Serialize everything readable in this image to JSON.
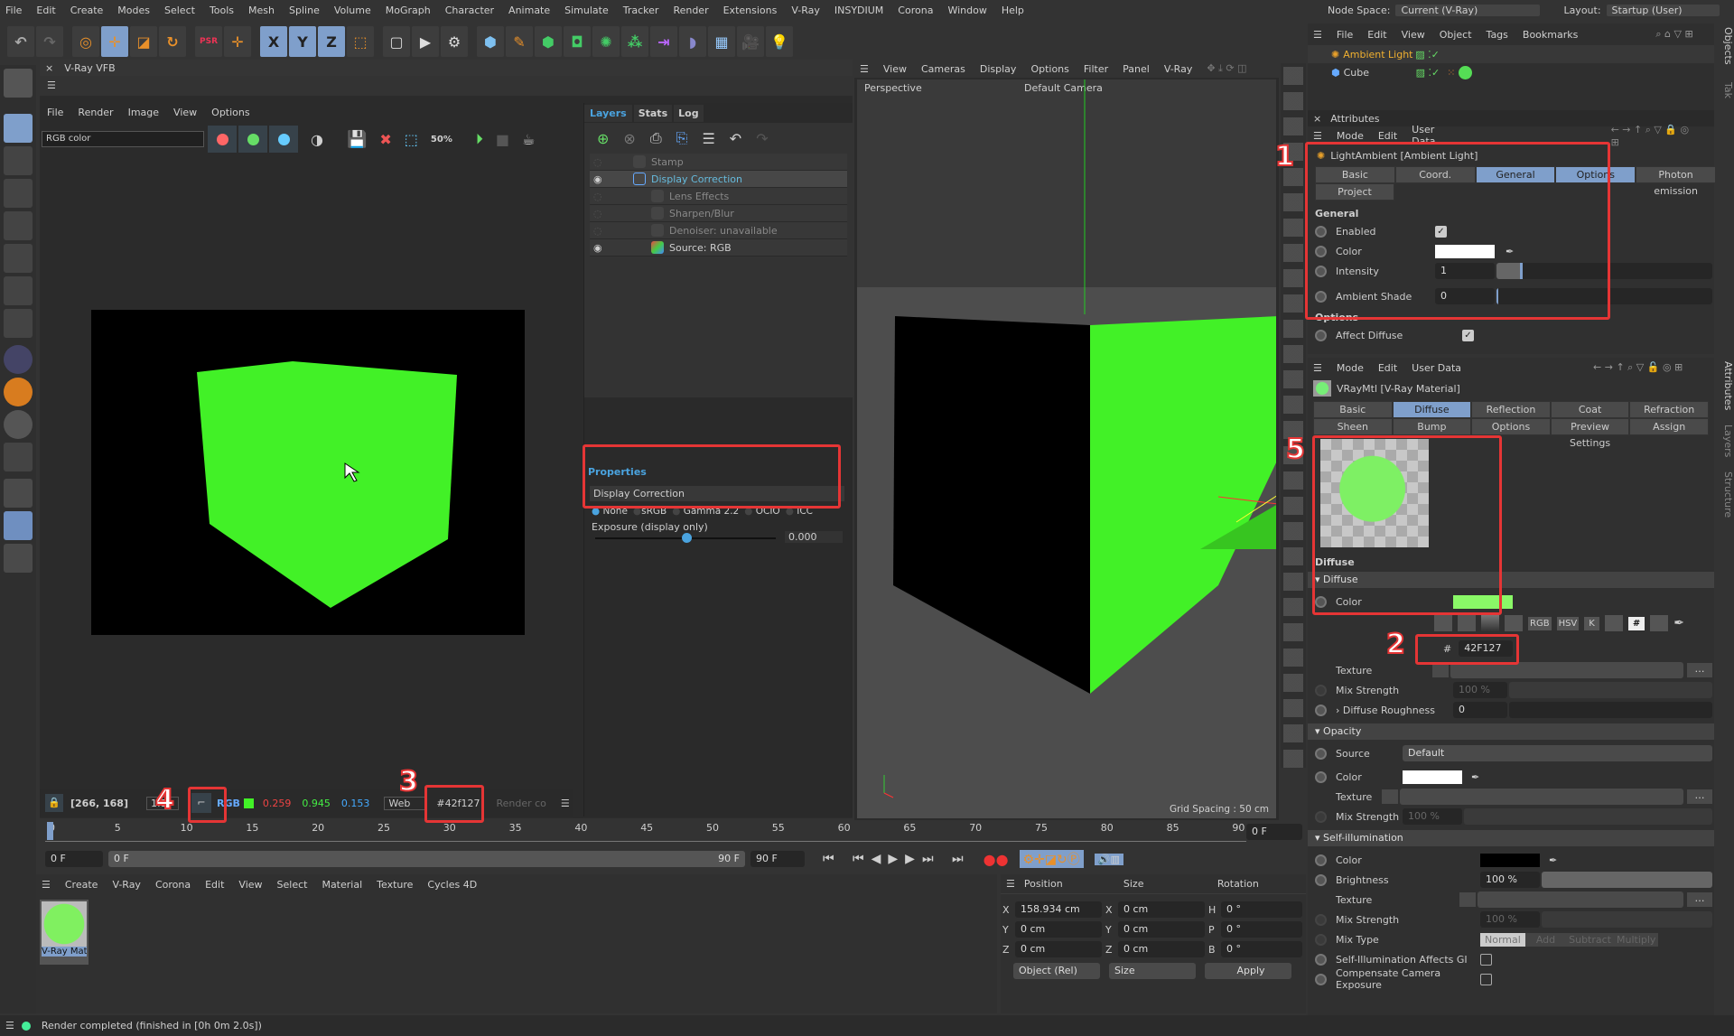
{
  "menubar": {
    "items": [
      "File",
      "Edit",
      "Create",
      "Modes",
      "Select",
      "Tools",
      "Mesh",
      "Spline",
      "Volume",
      "MoGraph",
      "Character",
      "Animate",
      "Simulate",
      "Tracker",
      "Render",
      "Extensions",
      "V-Ray",
      "INSYDIUM",
      "Corona",
      "Window",
      "Help"
    ],
    "node_space_label": "Node Space:",
    "node_space_value": "Current (V-Ray)",
    "layout_label": "Layout:",
    "layout_value": "Startup (User)"
  },
  "toolbar": {
    "icons": [
      "undo-icon",
      "redo-icon",
      "select-icon",
      "move-icon",
      "scale-icon",
      "rotate-icon",
      "psr-icon",
      "axis-icon",
      "x-axis-icon",
      "y-axis-icon",
      "z-axis-icon",
      "coordinate-system-icon",
      "render-view-icon",
      "render-icon",
      "render-settings-icon",
      "cube-icon",
      "pen-icon",
      "subdivision-icon",
      "extrude-icon",
      "cloner-icon",
      "array-icon",
      "symmetry-icon",
      "deformer-icon",
      "floor-icon",
      "camera-icon",
      "light-icon"
    ],
    "xyz": [
      "X",
      "Y",
      "Z"
    ]
  },
  "vfb": {
    "title": "V-Ray VFB",
    "menu": [
      "File",
      "Render",
      "Image",
      "View",
      "Options"
    ],
    "channel": "RGB color",
    "cube_color": "#42f127",
    "tabs": [
      "Layers",
      "Stats",
      "Log"
    ],
    "layers": [
      {
        "name": "Stamp",
        "visible": false
      },
      {
        "name": "Display Correction",
        "visible": true,
        "selected": true
      },
      {
        "name": "Lens Effects",
        "visible": false
      },
      {
        "name": "Sharpen/Blur",
        "visible": false
      },
      {
        "name": "Denoiser: unavailable",
        "visible": false
      },
      {
        "name": "Source: RGB",
        "visible": true
      }
    ],
    "properties_title": "Properties",
    "properties_header": "Display Correction",
    "correction_options": [
      "None",
      "sRGB",
      "Gamma 2.2",
      "OCIO",
      "ICC"
    ],
    "correction_selected": "None",
    "exposure_label": "Exposure (display only)",
    "exposure_value": "0.000",
    "exposure_fraction": 0.5,
    "status": {
      "coords": "[266, 168]",
      "zoom": "1:1",
      "rgb_label": "RGB",
      "r": "0.259",
      "g": "0.945",
      "b": "0.153",
      "color_space": "Web",
      "hex": "#42f127",
      "render_label": "Render co"
    }
  },
  "viewport": {
    "menu": [
      "View",
      "Cameras",
      "Display",
      "Options",
      "Filter",
      "Panel",
      "V-Ray"
    ],
    "label": "Perspective",
    "camera": "Default Camera",
    "grid": "Grid Spacing : 50 cm"
  },
  "objects": {
    "menu": [
      "File",
      "Edit",
      "View",
      "Object",
      "Tags",
      "Bookmarks"
    ],
    "items": [
      "Ambient Light",
      "Cube"
    ],
    "side_tabs": [
      "Objects",
      "Tak"
    ]
  },
  "attributes_top": {
    "title": "Attributes",
    "menu": [
      "Mode",
      "Edit",
      "User Data"
    ],
    "object": "LightAmbient [Ambient Light]",
    "tabs": [
      "Basic",
      "Coord.",
      "General",
      "Options",
      "Photon emission",
      "Project"
    ],
    "active_tabs": [
      "General",
      "Options"
    ],
    "section": "General",
    "enabled_label": "Enabled",
    "color_label": "Color",
    "color_value": "#ffffff",
    "intensity_label": "Intensity",
    "intensity_value": "1",
    "shade_label": "Ambient Shade",
    "shade_value": "0",
    "options_section": "Options",
    "affect_diffuse_label": "Affect Diffuse"
  },
  "attributes_mat": {
    "menu": [
      "Mode",
      "Edit",
      "User Data"
    ],
    "object": "VRayMtl [V-Ray Material]",
    "tabs_row1": [
      "Basic",
      "Diffuse",
      "Reflection",
      "Coat",
      "Refraction"
    ],
    "tabs_row2": [
      "Sheen",
      "Bump",
      "Options",
      "Preview Settings",
      "Assign"
    ],
    "active_tab": "Diffuse",
    "section": "Diffuse",
    "group": "Diffuse",
    "color_label": "Color",
    "color_value": "#8af867",
    "picker_icons": [
      "RGB",
      "HSV",
      "K",
      "#"
    ],
    "hex_prefix": "#",
    "hex_value": "42F127",
    "texture_label": "Texture",
    "mix_label": "Mix Strength",
    "mix_value": "100 %",
    "roughness_label": "Diffuse Roughness",
    "roughness_value": "0",
    "opacity": {
      "title": "Opacity",
      "source_label": "Source",
      "source_value": "Default",
      "color_label": "Color",
      "texture_label": "Texture",
      "mix_label": "Mix Strength",
      "mix_value": "100 %"
    },
    "selfillum": {
      "title": "Self-illumination",
      "color_label": "Color",
      "brightness_label": "Brightness",
      "brightness_value": "100 %",
      "texture_label": "Texture",
      "mix_label": "Mix Strength",
      "mix_value": "100 %",
      "mixtype_label": "Mix Type",
      "mixtypes": [
        "Normal",
        "Add",
        "Subtract",
        "Multiply"
      ],
      "affects_gi": "Self-Illumination Affects GI",
      "compensate": "Compensate Camera Exposure"
    },
    "side_tabs": [
      "Attributes",
      "Layers",
      "Structure"
    ]
  },
  "timeline": {
    "ticks": [
      "0",
      "5",
      "10",
      "15",
      "20",
      "25",
      "30",
      "35",
      "40",
      "45",
      "50",
      "55",
      "60",
      "65",
      "70",
      "75",
      "80",
      "85",
      "90"
    ],
    "current": "0 F",
    "start": "0 F",
    "range_start": "0 F",
    "range_end": "90 F",
    "end": "90 F",
    "frame_field": "0 F"
  },
  "materials": {
    "menu": [
      "Create",
      "V-Ray",
      "Corona",
      "Edit",
      "View",
      "Select",
      "Material",
      "Texture",
      "Cycles 4D"
    ],
    "items": [
      "V-Ray Mate"
    ]
  },
  "coords": {
    "headers": [
      "Position",
      "Size",
      "Rotation"
    ],
    "rows": [
      {
        "a": "X",
        "pos": "158.934 cm",
        "b": "X",
        "size": "0 cm",
        "c": "H",
        "rot": "0 °"
      },
      {
        "a": "Y",
        "pos": "0 cm",
        "b": "Y",
        "size": "0 cm",
        "c": "P",
        "rot": "0 °"
      },
      {
        "a": "Z",
        "pos": "0 cm",
        "b": "Z",
        "size": "0 cm",
        "c": "B",
        "rot": "0 °"
      }
    ],
    "mode": "Object (Rel)",
    "size_mode": "Size",
    "apply": "Apply"
  },
  "status": {
    "text": "Render completed (finished in [0h  0m  2.0s])"
  },
  "annotations": [
    "1",
    "2",
    "3",
    "4",
    "5"
  ],
  "colors": {
    "accent": "#7f9fcb",
    "annotation": "#e53535",
    "cube": "#42f127"
  }
}
